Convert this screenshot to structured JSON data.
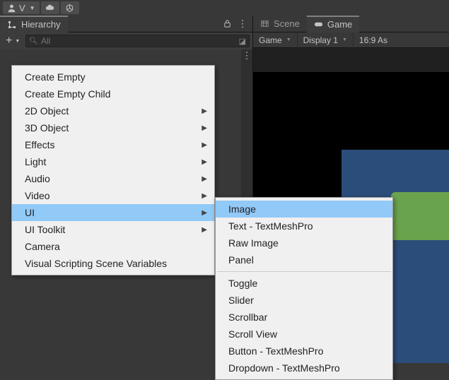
{
  "toolbar": {
    "account_label": "V"
  },
  "hierarchy": {
    "tab_label": "Hierarchy",
    "search_placeholder": "All"
  },
  "game_tabs": {
    "scene": "Scene",
    "game": "Game"
  },
  "game_toolbar": {
    "mode": "Game",
    "display": "Display 1",
    "aspect": "16:9 As"
  },
  "ctx1": {
    "items": [
      {
        "label": "Create Empty",
        "sub": false
      },
      {
        "label": "Create Empty Child",
        "sub": false
      },
      {
        "label": "2D Object",
        "sub": true
      },
      {
        "label": "3D Object",
        "sub": true
      },
      {
        "label": "Effects",
        "sub": true
      },
      {
        "label": "Light",
        "sub": true
      },
      {
        "label": "Audio",
        "sub": true
      },
      {
        "label": "Video",
        "sub": true
      },
      {
        "label": "UI",
        "sub": true,
        "hl": true
      },
      {
        "label": "UI Toolkit",
        "sub": true
      },
      {
        "label": "Camera",
        "sub": false
      },
      {
        "label": "Visual Scripting Scene Variables",
        "sub": false
      }
    ]
  },
  "ctx2": {
    "group1": [
      {
        "label": "Image",
        "hl": true
      },
      {
        "label": "Text - TextMeshPro"
      },
      {
        "label": "Raw Image"
      },
      {
        "label": "Panel"
      }
    ],
    "group2": [
      {
        "label": "Toggle"
      },
      {
        "label": "Slider"
      },
      {
        "label": "Scrollbar"
      },
      {
        "label": "Scroll View"
      },
      {
        "label": "Button - TextMeshPro"
      },
      {
        "label": "Dropdown - TextMeshPro"
      }
    ]
  }
}
